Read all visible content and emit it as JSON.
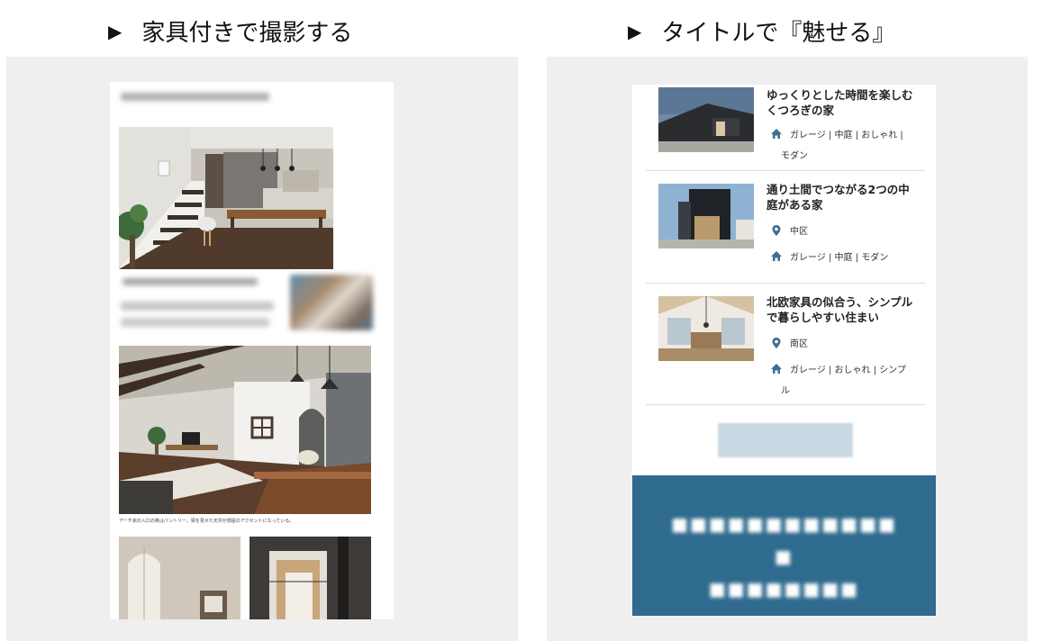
{
  "left": {
    "heading_marker": "▶",
    "heading": "家具付きで撮影する",
    "caption": "アーチ状の入口の奥はパントリー。梁を見せた天井が部屋のアクセントになっている。"
  },
  "right": {
    "heading_marker": "▶",
    "heading": "タイトルで『魅せる』",
    "items": [
      {
        "title": "ゆっくりとした時間を楽しむくつろぎの家",
        "tags": "ガレージ | 中庭 | おしゃれ |",
        "tags_cont": "モダン"
      },
      {
        "title": "通り土間でつながる2つの中庭がある家",
        "area": "中区",
        "tags": "ガレージ | 中庭 | モダン"
      },
      {
        "title": "北欧家具の似合う、シンプルで暮らしやすい住まい",
        "area": "南区",
        "tags": "ガレージ | おしゃれ | シンプ",
        "tags_cont": "ル"
      }
    ],
    "icons": {
      "house": "house-icon",
      "pin": "map-pin-icon"
    },
    "accent_color": "#3e6e92",
    "footer_color": "#2f6b8e"
  }
}
